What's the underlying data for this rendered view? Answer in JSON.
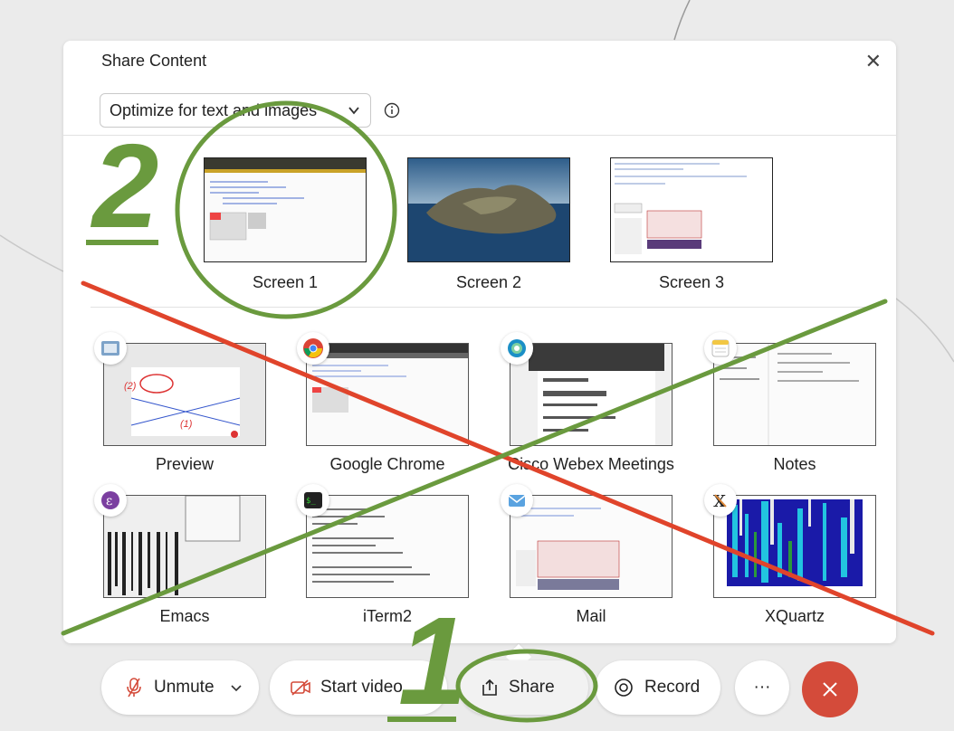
{
  "dialog": {
    "title": "Share Content",
    "close_icon": "close-icon",
    "optimize_select": {
      "value": "Optimize for text and images"
    },
    "info_icon": "info-icon"
  },
  "screens": [
    {
      "label": "Screen 1"
    },
    {
      "label": "Screen 2"
    },
    {
      "label": "Screen 3"
    }
  ],
  "apps": [
    {
      "label": "Preview",
      "icon": "preview-app-icon"
    },
    {
      "label": "Google Chrome",
      "icon": "chrome-app-icon"
    },
    {
      "label": "Cisco Webex Meetings",
      "icon": "webex-app-icon"
    },
    {
      "label": "Notes",
      "icon": "notes-app-icon"
    },
    {
      "label": "Emacs",
      "icon": "emacs-app-icon"
    },
    {
      "label": "iTerm2",
      "icon": "iterm2-app-icon"
    },
    {
      "label": "Mail",
      "icon": "mail-app-icon"
    },
    {
      "label": "XQuartz",
      "icon": "xquartz-app-icon"
    }
  ],
  "toolbar": {
    "unmute_label": "Unmute",
    "start_video_label": "Start video",
    "share_label": "Share",
    "record_label": "Record",
    "more_label": "···"
  },
  "annotations": {
    "step_one": "1",
    "step_two": "2",
    "thumb_marks": [
      "(2)",
      "(1)"
    ]
  },
  "colors": {
    "accent_red": "#d44b3a",
    "annotation_green": "#6a9a3e",
    "annotation_red": "#e0442b"
  }
}
